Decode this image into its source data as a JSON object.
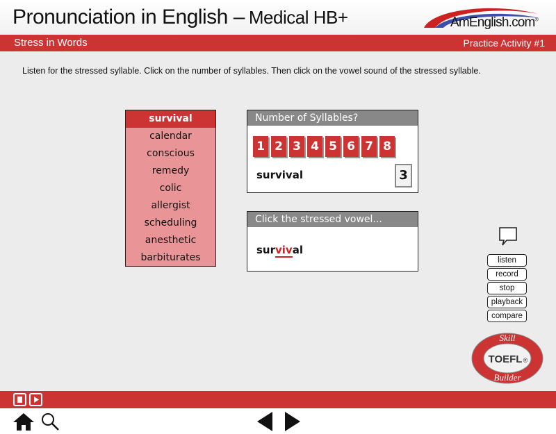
{
  "header": {
    "title": "Pronunciation in English –",
    "subtitle": "Medical HB+",
    "logo_text": "AmEnglish.com",
    "logo_mark": "®",
    "colors": {
      "brand_red": "#cc3333",
      "brand_blue": "#3b4fa8"
    }
  },
  "section_bar": {
    "section": "Stress in Words",
    "activity": "Practice Activity #1"
  },
  "instruction": "Listen for the stressed syllable. Click on the number of syllables.  Then click on the vowel sound of the stressed syllable.",
  "word_list": {
    "selected_index": 0,
    "items": [
      "survival",
      "calendar",
      "conscious",
      "remedy",
      "colic",
      "allergist",
      "scheduling",
      "anesthetic",
      "barbiturates"
    ]
  },
  "syllables_panel": {
    "heading": "Number of Syllables?",
    "numbers": [
      "1",
      "2",
      "3",
      "4",
      "5",
      "6",
      "7",
      "8"
    ],
    "word": "survival",
    "answer": "3"
  },
  "vowel_panel": {
    "heading": "Click the stressed vowel...",
    "word_before": "sur",
    "word_stressed": "viv",
    "word_after": "al"
  },
  "controls": {
    "speech_icon": "speech-bubble-icon",
    "buttons": [
      "listen",
      "record",
      "stop",
      "playback",
      "compare"
    ]
  },
  "badge": {
    "top": "Skill",
    "center": "TOEFL",
    "mark": "®",
    "bottom": "Builder"
  },
  "footer": {
    "media_icons": [
      "stop-icon",
      "play-icon"
    ],
    "nav_icons": [
      "home-icon",
      "search-icon",
      "previous-icon",
      "next-icon"
    ]
  }
}
